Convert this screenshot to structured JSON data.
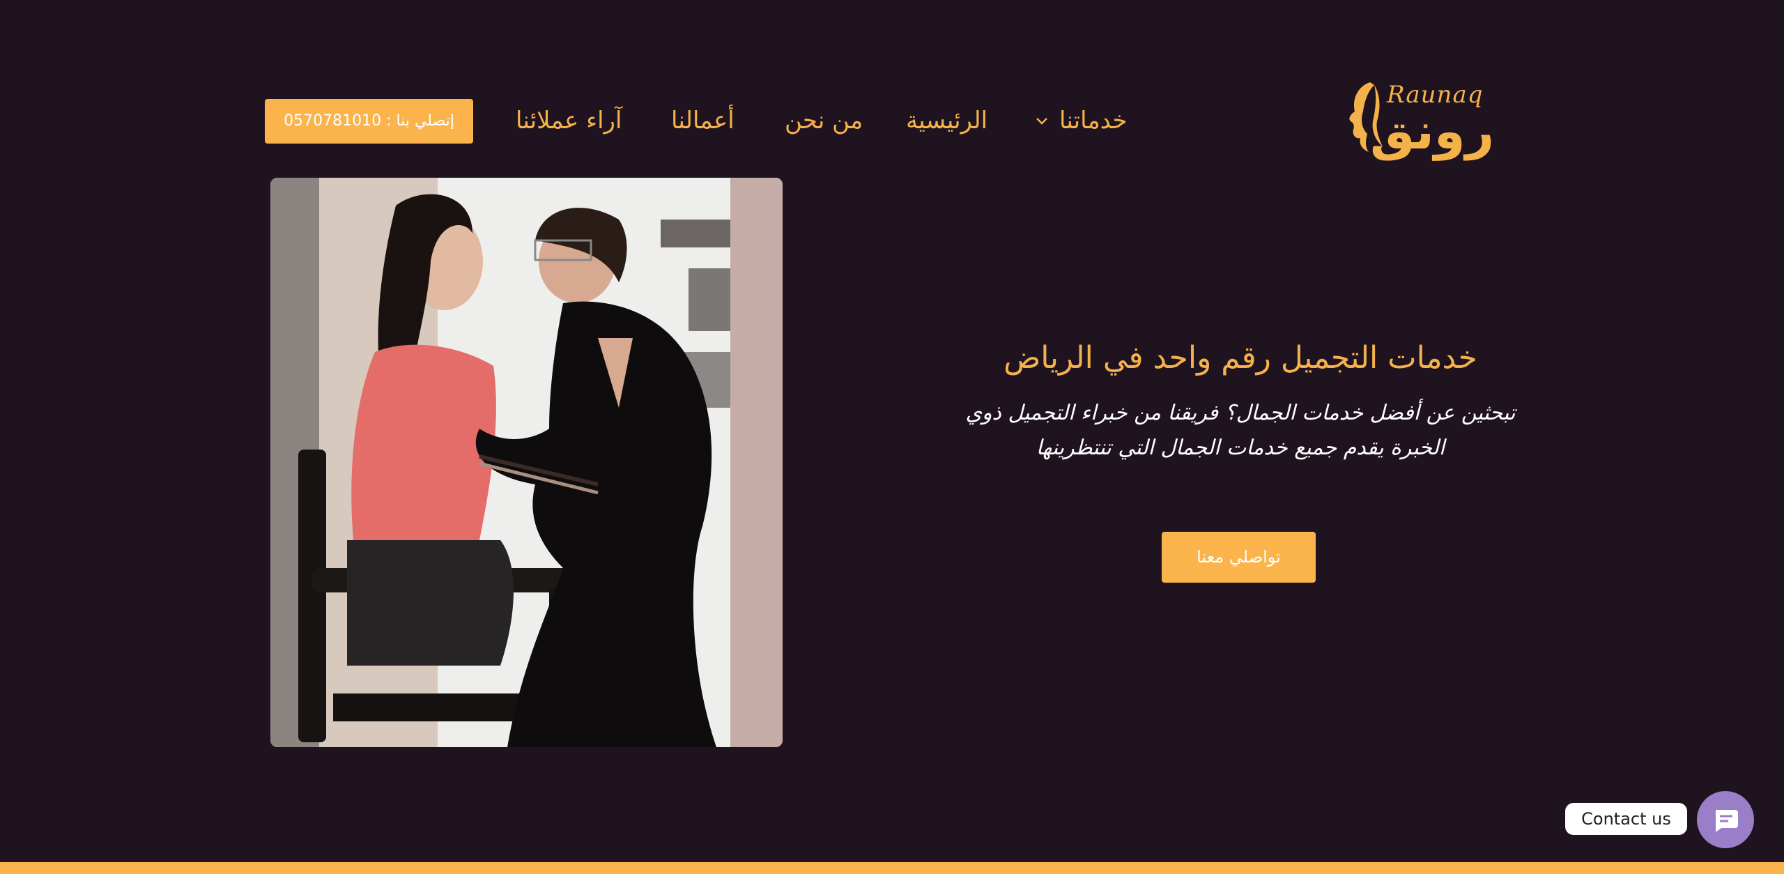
{
  "brand": {
    "logo_latin": "Raunaq",
    "logo_arabic": "رونق",
    "color": "#f6b24a"
  },
  "nav": {
    "services": "خدماتنا",
    "home": "الرئيسية",
    "about": "من نحن",
    "works": "أعمالنا",
    "reviews": "آراء عملائنا"
  },
  "header": {
    "call_button": "إتصلي بنا : 0570781010"
  },
  "hero": {
    "title": "خدمات التجميل رقم واحد في الرياض",
    "subtitle": "تبحثين عن أفضل خدمات الجمال؟ فريقنا من خبراء التجميل ذوي الخبرة يقدم جميع خدمات الجمال التي تنتظرينها",
    "cta": "تواصلي معنا"
  },
  "contact_widget": {
    "label": "Contact us",
    "icon": "chat-icon",
    "color": "#9b7ec8"
  },
  "colors": {
    "background": "#1f1320",
    "accent": "#fbb34c"
  }
}
